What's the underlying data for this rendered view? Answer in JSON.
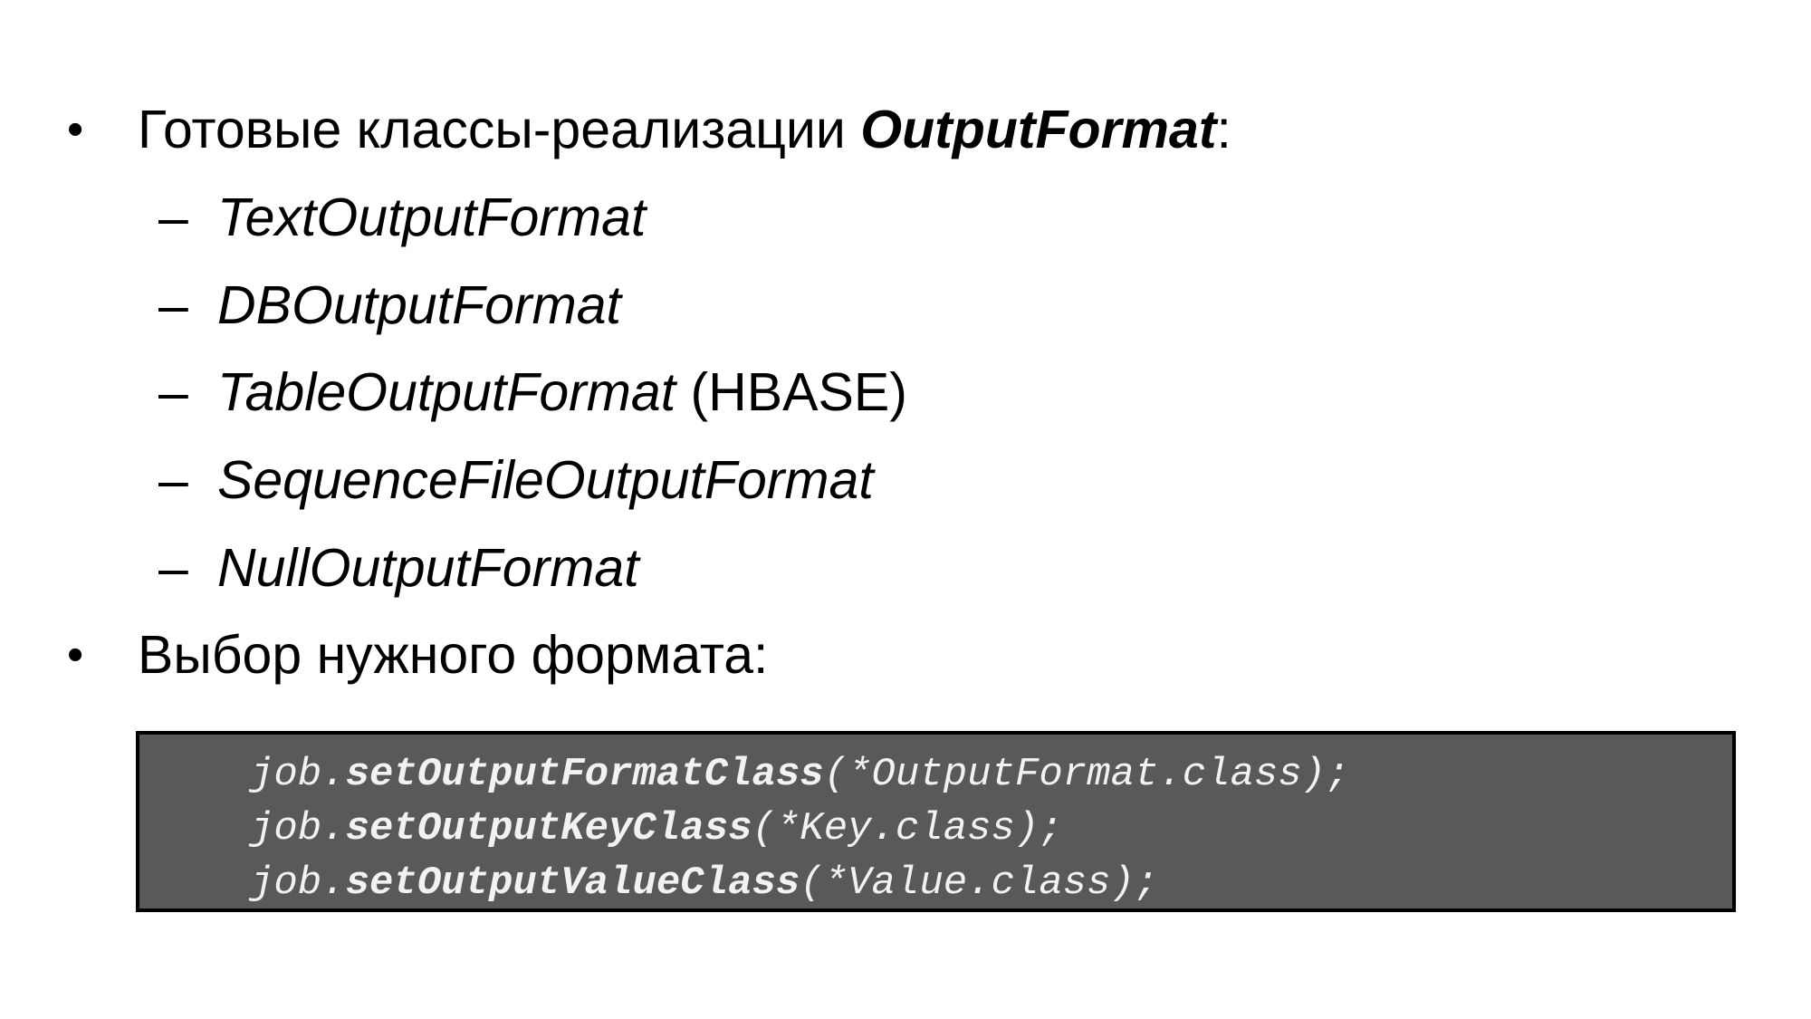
{
  "bullets": [
    {
      "text_before": "Готовые классы-реализации ",
      "emphasis": "OutputFormat",
      "text_after": ":"
    },
    {
      "text": "Выбор нужного формата:"
    }
  ],
  "bullet_symbol": "•",
  "dash_symbol": "–",
  "subitems": [
    {
      "name": "TextOutputFormat",
      "note": ""
    },
    {
      "name": "DBOutputFormat",
      "note": ""
    },
    {
      "name": "TableOutputFormat",
      "note": " (HBASE)"
    },
    {
      "name": "SequenceFileOutputFormat",
      "note": ""
    },
    {
      "name": "NullOutputFormat",
      "note": ""
    }
  ],
  "code": [
    {
      "obj": "job.",
      "method": "setOutputFormatClass",
      "args": "(*OutputFormat.class);"
    },
    {
      "obj": "job.",
      "method": "setOutputKeyClass",
      "args": "(*Key.class);"
    },
    {
      "obj": "job.",
      "method": "setOutputValueClass",
      "args": "(*Value.class);"
    }
  ],
  "colors": {
    "code_background": "#595959",
    "code_text": "#f2f2f2",
    "code_border": "#000000"
  }
}
